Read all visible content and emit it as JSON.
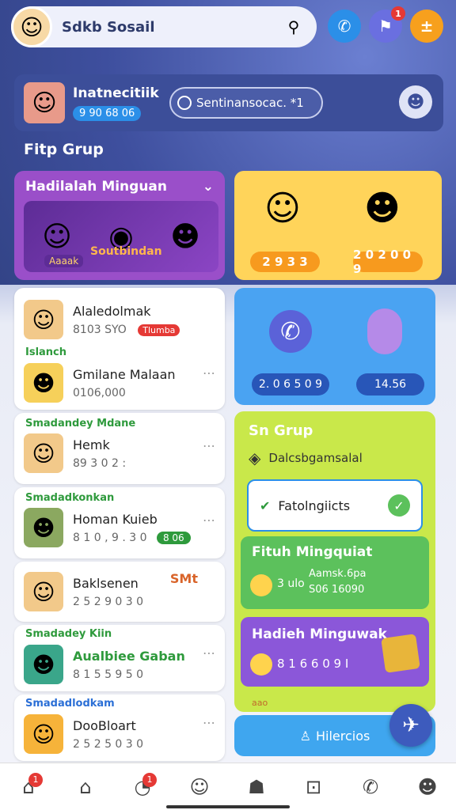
{
  "app": {
    "title": "Sdkb Sosail",
    "accent": "#3c4e99"
  },
  "header": {
    "avatar_icon": "user-avatar",
    "bell_icon": "bell-icon"
  },
  "top_buttons": [
    {
      "name": "phone",
      "color": "#2b8fe8",
      "icon": "phone-icon",
      "glyph": "✆"
    },
    {
      "name": "chat",
      "color": "#6a6fe0",
      "icon": "chat-icon",
      "glyph": "⚑",
      "badge": "1"
    },
    {
      "name": "menu",
      "color": "#f7a01d",
      "icon": "menu-icon",
      "glyph": "±"
    }
  ],
  "profile": {
    "name": "Inatnecitiik",
    "stat": "9 90 68 06",
    "search_placeholder": "Sentinansocac. *1"
  },
  "section_title": "Fitp Grup",
  "weekly": {
    "title": "Hadilalah Minguan",
    "banner": "Soutbindan",
    "tag": "Aaaak"
  },
  "yellow_card": {
    "pills": [
      "2 9 3 3",
      "2 0 2 0 0 9"
    ]
  },
  "list1": {
    "rows": [
      {
        "name": "Alaledolmak",
        "num": "8103 SYO",
        "tag": "Tlumba"
      },
      {
        "label": "Islanch",
        "name": "Gmilane Malaan",
        "num": "0106,000"
      }
    ]
  },
  "list2": {
    "label": "Smadandey Mdane",
    "name": "Hemk",
    "num": "89 3 0 2 :"
  },
  "list3": {
    "label": "Smadadkonkan",
    "name": "Homan Kuieb",
    "num": "8 1 0 , 9 . 3 0",
    "tag": "8 06"
  },
  "list4": {
    "name": "Baklsenen",
    "num": "2 5 2 9 0 3 0",
    "tag": "SMt"
  },
  "list5": {
    "label": "Smadadey Kiin",
    "name": "Aualbiee Gaban",
    "num": "8 1 5 5 9 5 0"
  },
  "list6": {
    "label": "Smadadlodkam",
    "name": "DooBloart",
    "num": "2 5 2 5 0 3 0"
  },
  "blue_card": {
    "pills": [
      "2. 0 6 5 0 9",
      "14.56"
    ]
  },
  "group_panel": {
    "title": "Sn Grup",
    "line1": "Dalcsbgamsalal",
    "feature": "Fatolngiicts",
    "green": {
      "title": "Fituh Mingquiat",
      "line1": "Aamsk.6pa",
      "line2": "S06 16090",
      "num": "3 ulo"
    },
    "purple": {
      "title": "Hadieh Minguwak",
      "num": "8 1 6 6 0 9 I"
    },
    "bar": "Hilercios",
    "bar_prefix": "aao"
  },
  "nav": [
    {
      "name": "home",
      "icon": "home-icon",
      "glyph": "⌂",
      "badge": "1"
    },
    {
      "name": "house",
      "icon": "house-icon",
      "glyph": "⌂"
    },
    {
      "name": "notifications",
      "icon": "chat-bubble-icon",
      "glyph": "◔",
      "badge": "1"
    },
    {
      "name": "friends",
      "icon": "people-icon",
      "glyph": "☺"
    },
    {
      "name": "profile",
      "icon": "person-icon",
      "glyph": "☗"
    },
    {
      "name": "grid",
      "icon": "grid-icon",
      "glyph": "⊡"
    },
    {
      "name": "calls",
      "icon": "phone-icon",
      "glyph": "✆"
    },
    {
      "name": "account",
      "icon": "user-icon",
      "glyph": "☻"
    }
  ]
}
